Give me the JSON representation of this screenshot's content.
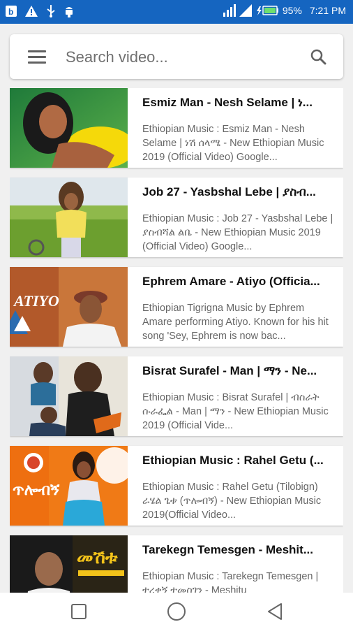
{
  "status_bar": {
    "battery": "95%",
    "time": "7:21 PM",
    "notification_icons": [
      "notification-b-icon",
      "warning-icon",
      "usb-icon",
      "android-debug-icon"
    ]
  },
  "search": {
    "placeholder": "Search video..."
  },
  "videos": [
    {
      "title": "Esmiz Man - Nesh Selame | ነ...",
      "description": "Ethiopian Music : Esmiz Man - Nesh Selame | ነሽ ሰላሜ - New Ethiopian Music 2019 (Official Video) Google..."
    },
    {
      "title": "Job 27 - Yasbshal Lebe | ያስብ...",
      "description": "Ethiopian Music : Job 27 - Yasbshal Lebe | ያስብሻል ልቤ - New Ethiopian Music 2019 (Official Video) Google..."
    },
    {
      "title": "Ephrem Amare - Atiyo (Officia...",
      "description": "Ethiopian Tigrigna Music by Ephrem Amare performing Atiyo. Known for his hit song 'Sey, Ephrem is now bac...",
      "thumb_text": "ATIYO"
    },
    {
      "title": "Bisrat Surafel - Man | ማን - Ne...",
      "description": "Ethiopian Music : Bisrat Surafel | ብስራት ሱራፌል - Man | ማን - New Ethiopian Music 2019 (Official Vide..."
    },
    {
      "title": "Ethiopian Music : Rahel Getu (...",
      "description": "Ethiopian Music : Rahel Getu (Tilobign) ራሄል ጌቱ (ጥሎብኝ) - New Ethiopian Music 2019(Official Video...",
      "thumb_text": "ጥሎብኝ"
    },
    {
      "title": "Tarekegn Temesgen - Meshit...",
      "description": "Ethiopian Music : Tarekegn Temesgen | ተረቀኝ ተመስገን - Meshitu",
      "thumb_text": "መሽቱ"
    }
  ],
  "nav": {
    "buttons": [
      "recents-square-icon",
      "home-circle-icon",
      "back-triangle-icon"
    ]
  },
  "colors": {
    "status_bar": "#1565c0",
    "background": "#f0f0f0"
  }
}
